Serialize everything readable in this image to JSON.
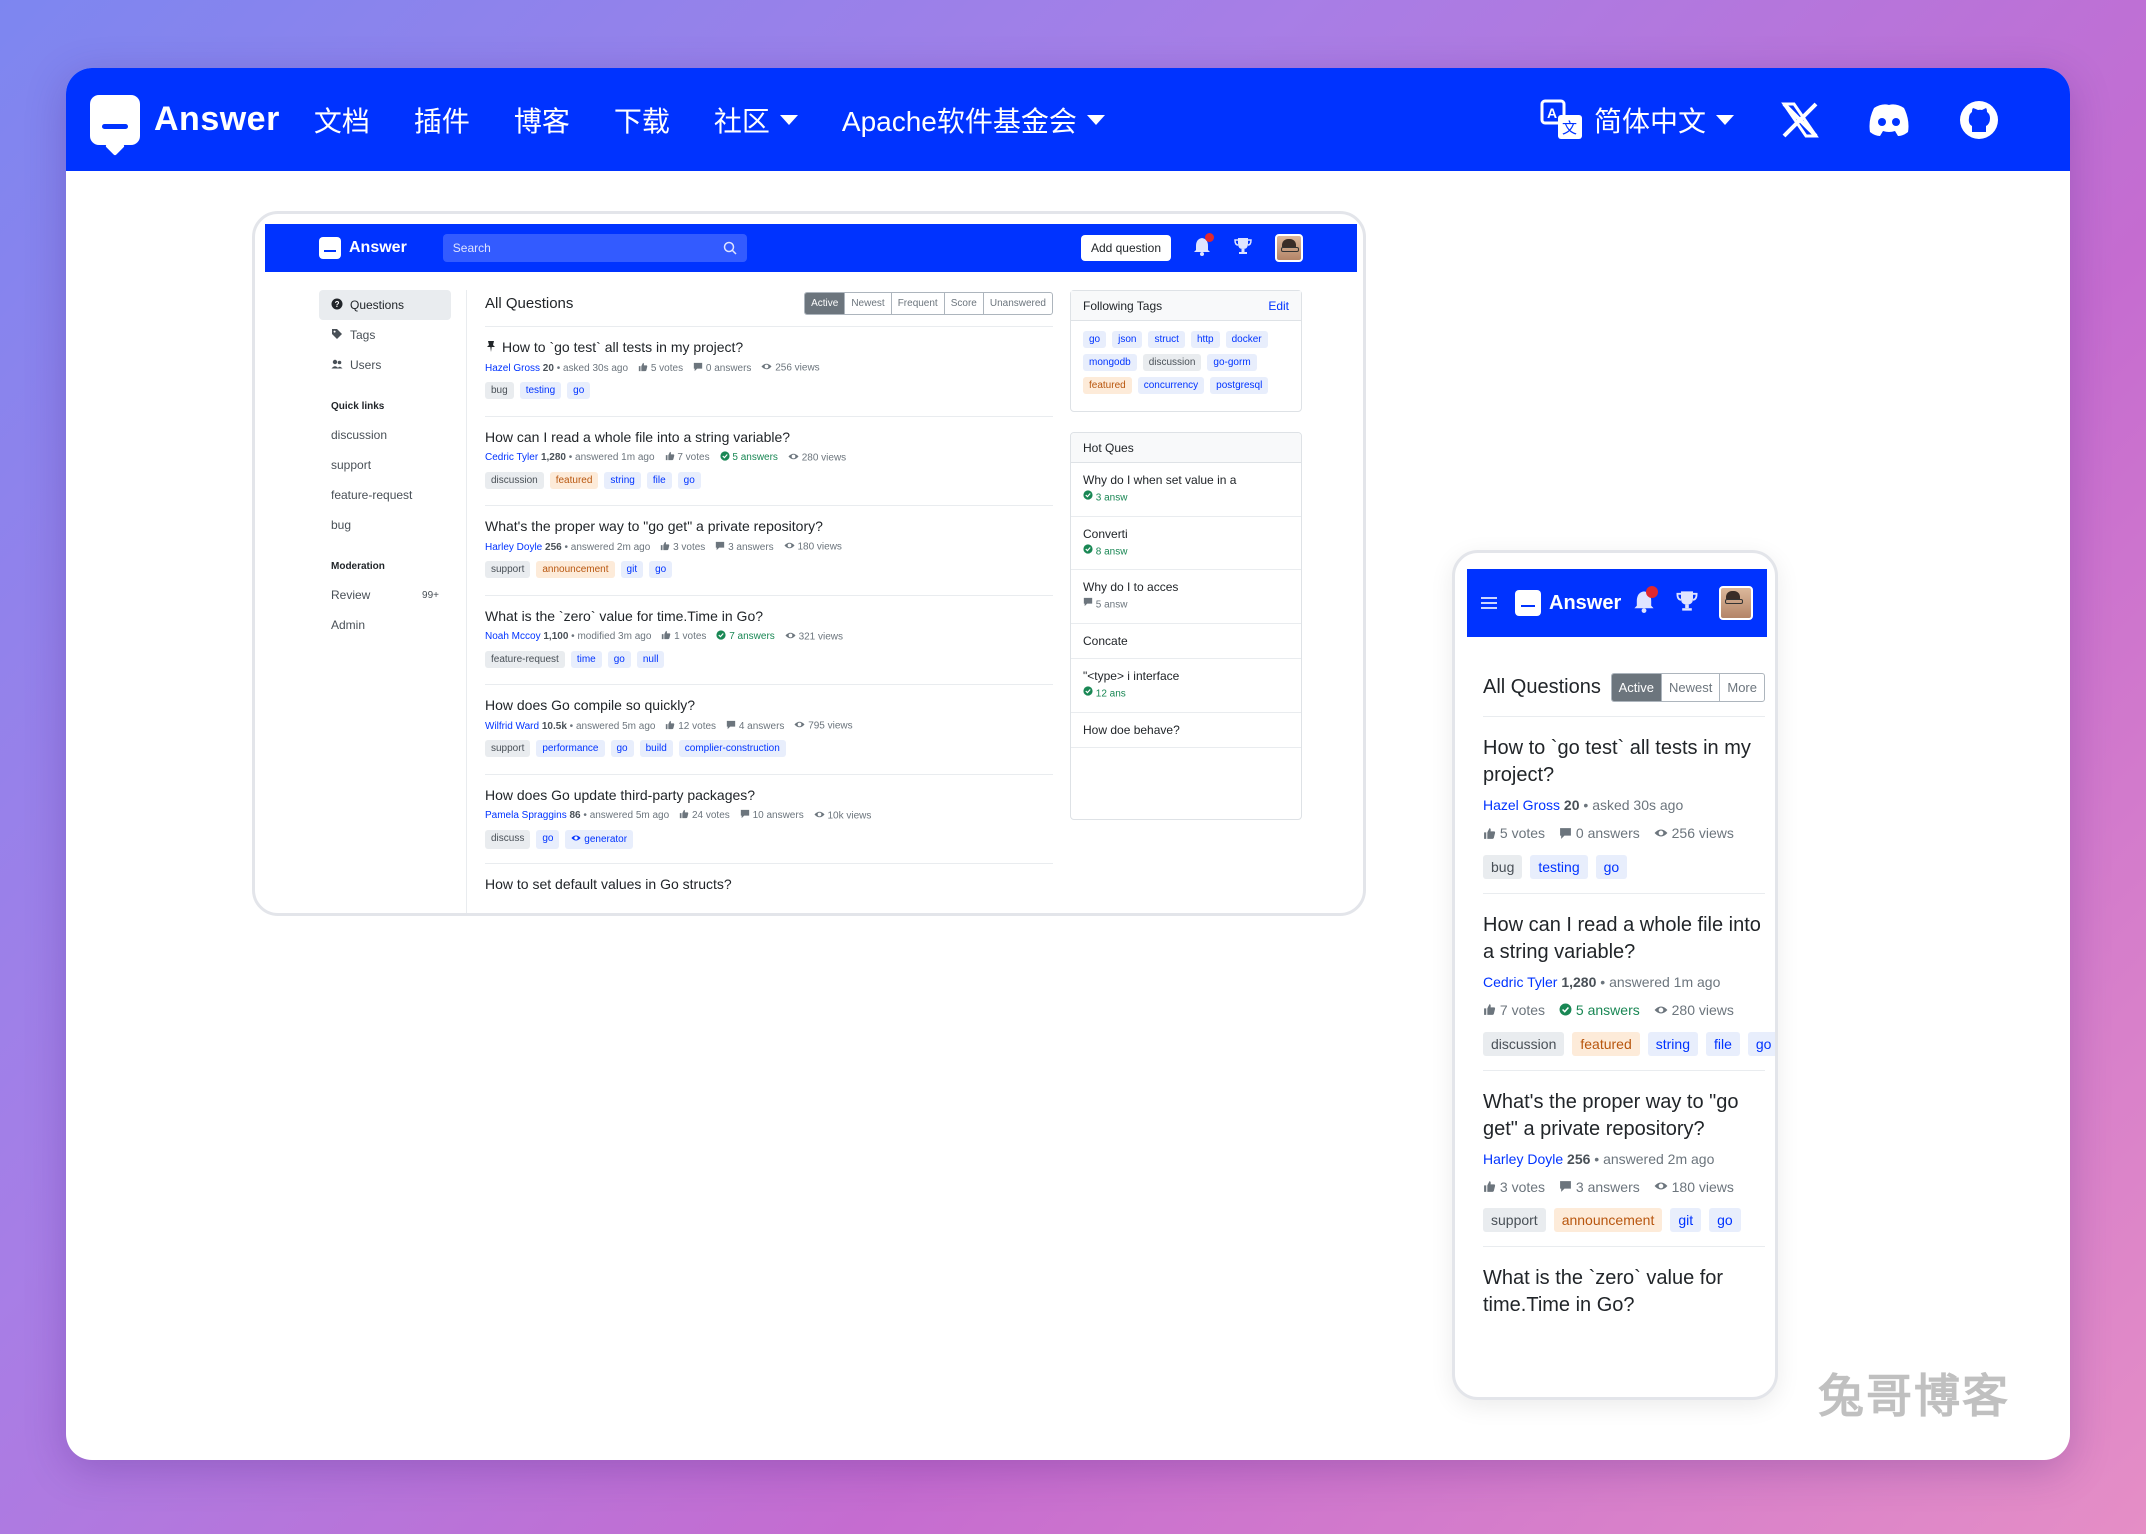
{
  "site": {
    "logo_text": "Answer",
    "links": [
      {
        "label": "文档",
        "dropdown": false
      },
      {
        "label": "插件",
        "dropdown": false
      },
      {
        "label": "博客",
        "dropdown": false
      },
      {
        "label": "下载",
        "dropdown": false
      },
      {
        "label": "社区",
        "dropdown": true
      },
      {
        "label": "Apache软件基金会",
        "dropdown": true
      }
    ],
    "language": "简体中文",
    "social_icons": [
      "x-icon",
      "discord-icon",
      "github-icon"
    ],
    "brand_color": "#0033ff"
  },
  "desktop": {
    "logo_text": "Answer",
    "search_placeholder": "Search",
    "add_question": "Add question",
    "sidebar": {
      "items": [
        {
          "label": "Questions",
          "icon": "question-circle-icon",
          "active": true
        },
        {
          "label": "Tags",
          "icon": "tag-icon",
          "active": false
        },
        {
          "label": "Users",
          "icon": "users-icon",
          "active": false
        }
      ],
      "quick_links_title": "Quick links",
      "quick_links": [
        "discussion",
        "support",
        "feature-request",
        "bug"
      ],
      "moderation_title": "Moderation",
      "review_label": "Review",
      "review_count": "99+",
      "admin_label": "Admin"
    },
    "main_title": "All Questions",
    "sort_tabs": [
      "Active",
      "Newest",
      "Frequent",
      "Score",
      "Unanswered"
    ],
    "questions": [
      {
        "title": "How to `go test` all tests in my project?",
        "pinned": true,
        "user": "Hazel Gross",
        "rep": "20",
        "action": "asked 30s ago",
        "votes": "5 votes",
        "answers": "0 answers",
        "accepted": false,
        "views": "256 views",
        "tags": [
          {
            "t": "bug",
            "k": "g"
          },
          {
            "t": "testing",
            "k": "b"
          },
          {
            "t": "go",
            "k": "b"
          }
        ]
      },
      {
        "title": "How can I read a whole file into a string variable?",
        "pinned": false,
        "user": "Cedric Tyler",
        "rep": "1,280",
        "action": "answered 1m ago",
        "votes": "7 votes",
        "answers": "5 answers",
        "accepted": true,
        "views": "280 views",
        "tags": [
          {
            "t": "discussion",
            "k": "g"
          },
          {
            "t": "featured",
            "k": "o"
          },
          {
            "t": "string",
            "k": "b"
          },
          {
            "t": "file",
            "k": "b"
          },
          {
            "t": "go",
            "k": "b"
          }
        ]
      },
      {
        "title": "What's the proper way to \"go get\" a private repository?",
        "pinned": false,
        "user": "Harley Doyle",
        "rep": "256",
        "action": "answered 2m ago",
        "votes": "3 votes",
        "answers": "3 answers",
        "accepted": false,
        "views": "180 views",
        "tags": [
          {
            "t": "support",
            "k": "g"
          },
          {
            "t": "announcement",
            "k": "o"
          },
          {
            "t": "git",
            "k": "b"
          },
          {
            "t": "go",
            "k": "b"
          }
        ]
      },
      {
        "title": "What is the `zero` value for time.Time in Go?",
        "pinned": false,
        "user": "Noah Mccoy",
        "rep": "1,100",
        "action": "modified 3m ago",
        "votes": "1 votes",
        "answers": "7 answers",
        "accepted": true,
        "views": "321 views",
        "tags": [
          {
            "t": "feature-request",
            "k": "g"
          },
          {
            "t": "time",
            "k": "b"
          },
          {
            "t": "go",
            "k": "b"
          },
          {
            "t": "null",
            "k": "b"
          }
        ]
      },
      {
        "title": "How does Go compile so quickly?",
        "pinned": false,
        "user": "Wilfrid Ward",
        "rep": "10.5k",
        "action": "answered 5m ago",
        "votes": "12 votes",
        "answers": "4 answers",
        "accepted": false,
        "views": "795 views",
        "tags": [
          {
            "t": "support",
            "k": "g"
          },
          {
            "t": "performance",
            "k": "b"
          },
          {
            "t": "go",
            "k": "b"
          },
          {
            "t": "build",
            "k": "b"
          },
          {
            "t": "complier-construction",
            "k": "b"
          }
        ]
      },
      {
        "title": "How does Go update third-party packages?",
        "pinned": false,
        "user": "Pamela Spraggins",
        "rep": "86",
        "action": "answered 5m ago",
        "votes": "24 votes",
        "answers": "10 answers",
        "accepted": false,
        "views": "10k views",
        "tags": [
          {
            "t": "discuss",
            "k": "g"
          },
          {
            "t": "go",
            "k": "b"
          },
          {
            "t": "generator",
            "k": "b",
            "icon": true
          }
        ]
      },
      {
        "title": "How to set default values in Go structs?",
        "pinned": false,
        "user": "",
        "rep": "",
        "action": "",
        "votes": "",
        "answers": "",
        "accepted": false,
        "views": "",
        "tags": []
      }
    ],
    "following_tags": {
      "title": "Following Tags",
      "edit": "Edit",
      "tags": [
        {
          "t": "go",
          "k": "b"
        },
        {
          "t": "json",
          "k": "b"
        },
        {
          "t": "struct",
          "k": "b"
        },
        {
          "t": "http",
          "k": "b"
        },
        {
          "t": "docker",
          "k": "b"
        },
        {
          "t": "mongodb",
          "k": "b"
        },
        {
          "t": "discussion",
          "k": "g"
        },
        {
          "t": "go-gorm",
          "k": "b"
        },
        {
          "t": "featured",
          "k": "o"
        },
        {
          "t": "concurrency",
          "k": "b"
        },
        {
          "t": "postgresql",
          "k": "b"
        }
      ]
    },
    "hot_questions": {
      "title": "Hot Ques",
      "items": [
        {
          "text": "Why do I when set value in a",
          "answers": "3 answ",
          "accepted": true
        },
        {
          "text": "Converti",
          "answers": "8 answ",
          "accepted": true
        },
        {
          "text": "Why do I to acces",
          "answers": "5 answ",
          "accepted": false
        },
        {
          "text": "Concate",
          "answers": "",
          "accepted": false
        },
        {
          "text": "\"<type> i interface",
          "answers": "12 ans",
          "accepted": true
        },
        {
          "text": "How doe behave?",
          "answers": "",
          "accepted": false
        }
      ]
    }
  },
  "mobile": {
    "logo_text": "Answer",
    "main_title": "All Questions",
    "sort_tabs": [
      "Active",
      "Newest",
      "More"
    ],
    "questions": [
      {
        "title": "How to `go test` all tests in my project?",
        "user": "Hazel Gross",
        "rep": "20",
        "action": "asked 30s ago",
        "votes": "5 votes",
        "answers": "0 answers",
        "accepted": false,
        "views": "256 views",
        "tags": [
          {
            "t": "bug",
            "k": "g"
          },
          {
            "t": "testing",
            "k": "b"
          },
          {
            "t": "go",
            "k": "b"
          }
        ]
      },
      {
        "title": "How can I read a whole file into a string variable?",
        "user": "Cedric Tyler",
        "rep": "1,280",
        "action": "answered 1m ago",
        "votes": "7 votes",
        "answers": "5 answers",
        "accepted": true,
        "views": "280 views",
        "tags": [
          {
            "t": "discussion",
            "k": "g"
          },
          {
            "t": "featured",
            "k": "o"
          },
          {
            "t": "string",
            "k": "b"
          },
          {
            "t": "file",
            "k": "b"
          },
          {
            "t": "go",
            "k": "b"
          }
        ]
      },
      {
        "title": "What's the proper way to \"go get\" a private repository?",
        "user": "Harley Doyle",
        "rep": "256",
        "action": "answered 2m ago",
        "votes": "3 votes",
        "answers": "3 answers",
        "accepted": false,
        "views": "180 views",
        "tags": [
          {
            "t": "support",
            "k": "g"
          },
          {
            "t": "announcement",
            "k": "o"
          },
          {
            "t": "git",
            "k": "b"
          },
          {
            "t": "go",
            "k": "b"
          }
        ]
      },
      {
        "title": "What is the `zero` value for time.Time in Go?",
        "user": "",
        "rep": "",
        "action": "",
        "votes": "",
        "answers": "",
        "accepted": false,
        "views": "",
        "tags": []
      }
    ]
  },
  "watermark": "兔哥博客"
}
